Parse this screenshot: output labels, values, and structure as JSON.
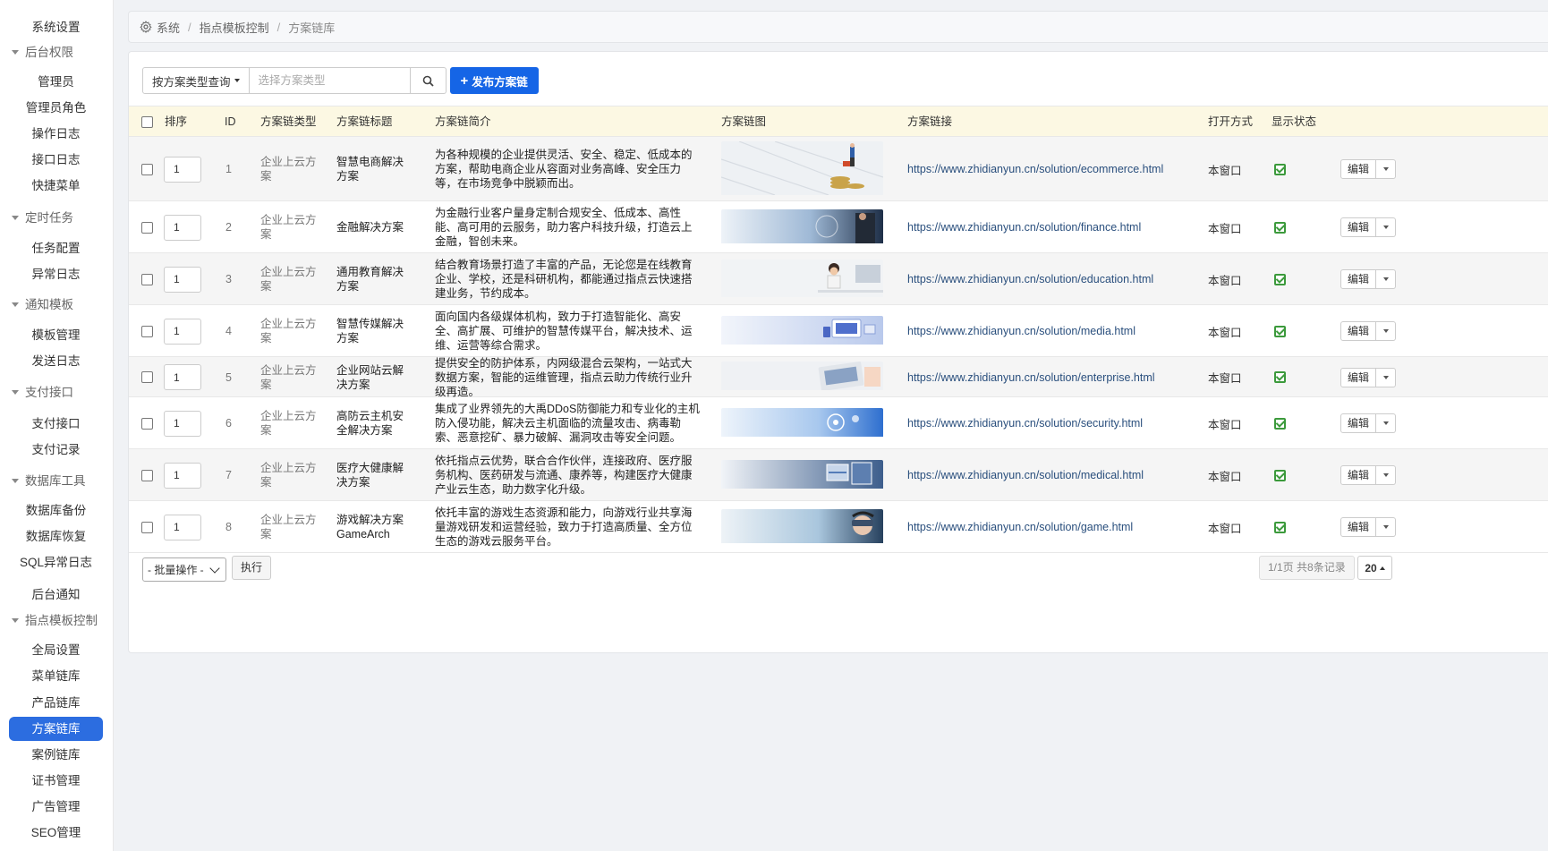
{
  "sidebar": {
    "top_item": "系统设置",
    "groups": {
      "admin": {
        "label": "后台权限",
        "items": [
          "管理员",
          "管理员角色",
          "操作日志",
          "接口日志",
          "快捷菜单"
        ]
      },
      "cron": {
        "label": "定时任务",
        "items": [
          "任务配置",
          "异常日志"
        ]
      },
      "notify": {
        "label": "通知模板",
        "items": [
          "模板管理",
          "发送日志"
        ]
      },
      "pay": {
        "label": "支付接口",
        "items": [
          "支付接口",
          "支付记录"
        ]
      },
      "db": {
        "label": "数据库工具",
        "items": [
          "数据库备份",
          "数据库恢复",
          "SQL异常日志"
        ]
      },
      "notice": "后台通知",
      "tpl": {
        "label": "指点模板控制",
        "items": [
          "全局设置",
          "菜单链库",
          "产品链库",
          "方案链库",
          "案例链库",
          "证书管理",
          "广告管理",
          "SEO管理"
        ]
      }
    },
    "active": "方案链库"
  },
  "breadcrumb": {
    "items": [
      "系统",
      "指点模板控制",
      "方案链库"
    ]
  },
  "toolbar": {
    "filter_label": "按方案类型查询",
    "search_placeholder": "选择方案类型",
    "publish_label": "发布方案链"
  },
  "table": {
    "headers": {
      "sort": "排序",
      "id": "ID",
      "type": "方案链类型",
      "title": "方案链标题",
      "desc": "方案链简介",
      "image": "方案链图",
      "url": "方案链接",
      "open": "打开方式",
      "status": "显示状态"
    },
    "rows": [
      {
        "sort": "1",
        "id": "1",
        "type": "企业上云方案",
        "title": "智慧电商解决方案",
        "desc": "为各种规模的企业提供灵活、安全、稳定、低成本的方案，帮助电商企业从容面对业务高峰、安全压力等，在市场竞争中脱颖而出。",
        "url": "https://www.zhidianyun.cn/solution/ecommerce.html",
        "open": "本窗口",
        "edit": "编辑",
        "thumb": "ecommerce"
      },
      {
        "sort": "1",
        "id": "2",
        "type": "企业上云方案",
        "title": "金融解决方案",
        "desc": "为金融行业客户量身定制合规安全、低成本、高性能、高可用的云服务，助力客户科技升级，打造云上金融，智创未来。",
        "url": "https://www.zhidianyun.cn/solution/finance.html",
        "open": "本窗口",
        "edit": "编辑",
        "thumb": "finance"
      },
      {
        "sort": "1",
        "id": "3",
        "type": "企业上云方案",
        "title": "通用教育解决方案",
        "desc": "结合教育场景打造了丰富的产品，无论您是在线教育企业、学校，还是科研机构，都能通过指点云快速搭建业务，节约成本。",
        "url": "https://www.zhidianyun.cn/solution/education.html",
        "open": "本窗口",
        "edit": "编辑",
        "thumb": "education"
      },
      {
        "sort": "1",
        "id": "4",
        "type": "企业上云方案",
        "title": "智慧传媒解决方案",
        "desc": "面向国内各级媒体机构，致力于打造智能化、高安全、高扩展、可维护的智慧传媒平台，解决技术、运维、运营等综合需求。",
        "url": "https://www.zhidianyun.cn/solution/media.html",
        "open": "本窗口",
        "edit": "编辑",
        "thumb": "media"
      },
      {
        "sort": "1",
        "id": "5",
        "type": "企业上云方案",
        "title": "企业网站云解决方案",
        "desc": "提供安全的防护体系，内网级混合云架构，一站式大数据方案，智能的运维管理，指点云助力传统行业升级再造。",
        "url": "https://www.zhidianyun.cn/solution/enterprise.html",
        "open": "本窗口",
        "edit": "编辑",
        "thumb": "enterprise"
      },
      {
        "sort": "1",
        "id": "6",
        "type": "企业上云方案",
        "title": "高防云主机安全解决方案",
        "desc": "集成了业界领先的大禹DDoS防御能力和专业化的主机防入侵功能，解决云主机面临的流量攻击、病毒勒索、恶意挖矿、暴力破解、漏洞攻击等安全问题。",
        "url": "https://www.zhidianyun.cn/solution/security.html",
        "open": "本窗口",
        "edit": "编辑",
        "thumb": "security"
      },
      {
        "sort": "1",
        "id": "7",
        "type": "企业上云方案",
        "title": "医疗大健康解决方案",
        "desc": "依托指点云优势，联合合作伙伴，连接政府、医疗服务机构、医药研发与流通、康养等，构建医疗大健康产业云生态，助力数字化升级。",
        "url": "https://www.zhidianyun.cn/solution/medical.html",
        "open": "本窗口",
        "edit": "编辑",
        "thumb": "medical"
      },
      {
        "sort": "1",
        "id": "8",
        "type": "企业上云方案",
        "title": "游戏解决方案GameArch",
        "desc": "依托丰富的游戏生态资源和能力，向游戏行业共享海量游戏研发和运营经验，致力于打造高质量、全方位生态的游戏云服务平台。",
        "url": "https://www.zhidianyun.cn/solution/game.html",
        "open": "本窗口",
        "edit": "编辑",
        "thumb": "game"
      }
    ]
  },
  "footer": {
    "batch_label": "- 批量操作 -",
    "exec_label": "执行",
    "page_info": "1/1页 共8条记录",
    "page_size": "20"
  },
  "colors": {
    "accent": "#1565e6",
    "sidebar_active": "#2c6de0",
    "thead_bg": "#fcf8e3",
    "status_ok": "#3c9a3c"
  }
}
